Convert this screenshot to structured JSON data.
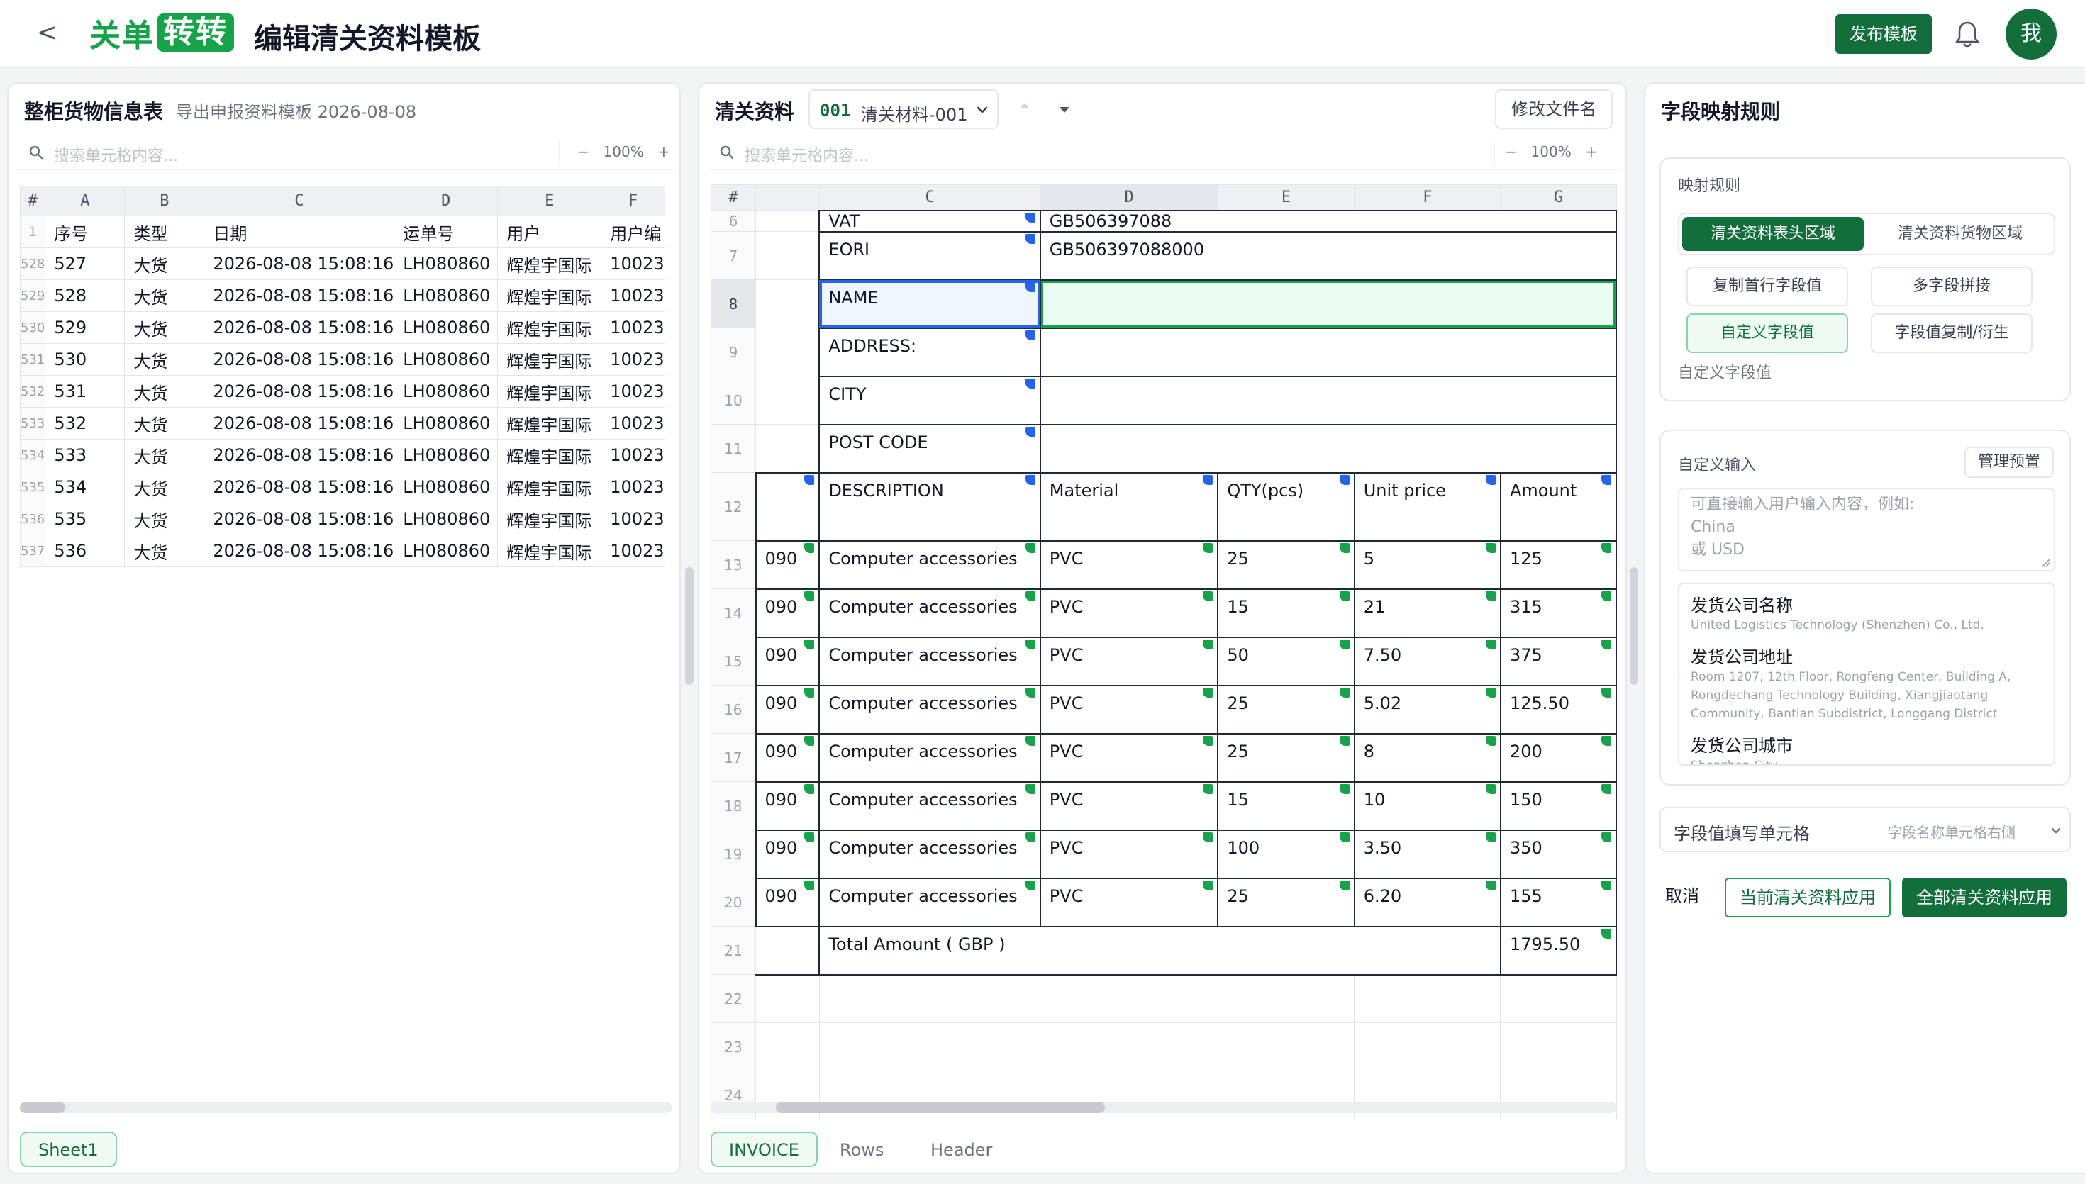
{
  "app": {
    "back": "<",
    "logo_a": "关单",
    "logo_b": "转转",
    "title": "编辑清关资料模板",
    "publish": "发布模板",
    "avatar": "我"
  },
  "left": {
    "title": "整柜货物信息表",
    "subtitle": "导出申报资料模板 2026-08-08",
    "search_placeholder": "搜索单元格内容...",
    "zoom_minus": "−",
    "zoom": "100%",
    "zoom_plus": "+",
    "columns": [
      "#",
      "A",
      "B",
      "C",
      "D",
      "E",
      "F"
    ],
    "header_row": {
      "n": "1",
      "cells": [
        "序号",
        "类型",
        "日期",
        "运单号",
        "用户",
        "用户编"
      ]
    },
    "rows": [
      {
        "n": "528",
        "cells": [
          "527",
          "大货",
          "2026-08-08 15:08:16",
          "LH080860",
          "辉煌宇国际",
          "10023"
        ]
      },
      {
        "n": "529",
        "cells": [
          "528",
          "大货",
          "2026-08-08 15:08:16",
          "LH080860",
          "辉煌宇国际",
          "10023"
        ]
      },
      {
        "n": "530",
        "cells": [
          "529",
          "大货",
          "2026-08-08 15:08:16",
          "LH080860",
          "辉煌宇国际",
          "10023"
        ]
      },
      {
        "n": "531",
        "cells": [
          "530",
          "大货",
          "2026-08-08 15:08:16",
          "LH080860",
          "辉煌宇国际",
          "10023"
        ]
      },
      {
        "n": "532",
        "cells": [
          "531",
          "大货",
          "2026-08-08 15:08:16",
          "LH080860",
          "辉煌宇国际",
          "10023"
        ]
      },
      {
        "n": "533",
        "cells": [
          "532",
          "大货",
          "2026-08-08 15:08:16",
          "LH080860",
          "辉煌宇国际",
          "10023"
        ]
      },
      {
        "n": "534",
        "cells": [
          "533",
          "大货",
          "2026-08-08 15:08:16",
          "LH080860",
          "辉煌宇国际",
          "10023"
        ]
      },
      {
        "n": "535",
        "cells": [
          "534",
          "大货",
          "2026-08-08 15:08:16",
          "LH080860",
          "辉煌宇国际",
          "10023"
        ]
      },
      {
        "n": "536",
        "cells": [
          "535",
          "大货",
          "2026-08-08 15:08:16",
          "LH080860",
          "辉煌宇国际",
          "10023"
        ]
      },
      {
        "n": "537",
        "cells": [
          "536",
          "大货",
          "2026-08-08 15:08:16",
          "LH080860",
          "辉煌宇国际",
          "10023"
        ]
      }
    ],
    "sheet_tab": "Sheet1"
  },
  "mid": {
    "title": "清关资料",
    "doc_code": "001",
    "doc_name": "清关材料-001",
    "rename": "修改文件名",
    "search_placeholder": "搜索单元格内容...",
    "zoom_minus": "−",
    "zoom": "100%",
    "zoom_plus": "+",
    "columns": [
      "#",
      "",
      "C",
      "D",
      "E",
      "F",
      "G"
    ],
    "info_rows": [
      {
        "n": "6",
        "label": "VAT",
        "value": "GB506397088"
      },
      {
        "n": "7",
        "label": "EORI",
        "value": "GB506397088000"
      },
      {
        "n": "8",
        "label": "NAME",
        "value": ""
      },
      {
        "n": "9",
        "label": "ADDRESS:",
        "value": ""
      },
      {
        "n": "10",
        "label": "CITY",
        "value": ""
      },
      {
        "n": "11",
        "label": "POST CODE",
        "value": ""
      }
    ],
    "table_header": {
      "n": "12",
      "cells": [
        "",
        "DESCRIPTION",
        "Material",
        "QTY(pcs)",
        "Unit price",
        "Amount"
      ]
    },
    "items": [
      {
        "n": "13",
        "cells": [
          "090",
          "Computer accessories",
          "PVC",
          "25",
          "5",
          "125"
        ]
      },
      {
        "n": "14",
        "cells": [
          "090",
          "Computer accessories",
          "PVC",
          "15",
          "21",
          "315"
        ]
      },
      {
        "n": "15",
        "cells": [
          "090",
          "Computer accessories",
          "PVC",
          "50",
          "7.50",
          "375"
        ]
      },
      {
        "n": "16",
        "cells": [
          "090",
          "Computer accessories",
          "PVC",
          "25",
          "5.02",
          "125.50"
        ]
      },
      {
        "n": "17",
        "cells": [
          "090",
          "Computer accessories",
          "PVC",
          "25",
          "8",
          "200"
        ]
      },
      {
        "n": "18",
        "cells": [
          "090",
          "Computer accessories",
          "PVC",
          "15",
          "10",
          "150"
        ]
      },
      {
        "n": "19",
        "cells": [
          "090",
          "Computer accessories",
          "PVC",
          "100",
          "3.50",
          "350"
        ]
      },
      {
        "n": "20",
        "cells": [
          "090",
          "Computer accessories",
          "PVC",
          "25",
          "6.20",
          "155"
        ]
      }
    ],
    "total": {
      "n": "21",
      "label": "Total Amount ( GBP )",
      "value": "1795.50"
    },
    "empty_rows": [
      "22",
      "23",
      "24"
    ],
    "tabs": [
      "INVOICE",
      "Rows",
      "Header"
    ]
  },
  "right": {
    "title": "字段映射规则",
    "rule_label": "映射规则",
    "seg": [
      "清关资料表头区域",
      "清关资料货物区域"
    ],
    "options": [
      "复制首行字段值",
      "多字段拼接",
      "自定义字段值",
      "字段值复制/衍生"
    ],
    "mode_caption": "自定义字段值",
    "custom_input_label": "自定义输入",
    "manage_preset": "管理预置",
    "textarea_placeholder_1": "可直接输入用户输入内容，例如:",
    "textarea_placeholder_2": "China",
    "textarea_placeholder_3": "或 USD",
    "presets": [
      {
        "title": "发货公司名称",
        "value": "United Logistics Technology (Shenzhen) Co., Ltd."
      },
      {
        "title": "发货公司地址",
        "value": "Room 1207, 12th Floor, Rongfeng Center, Building A, Rongdechang Technology Building, Xiangjiaotang Community, Bantian Subdistrict, Longgang District"
      },
      {
        "title": "发货公司城市",
        "value": "Shenzhen City"
      }
    ],
    "fill_cell_label": "字段值填写单元格",
    "fill_cell_value": "字段名称单元格右侧",
    "cancel": "取消",
    "apply_current": "当前清关资料应用",
    "apply_all": "全部清关资料应用"
  },
  "colors": {
    "brand": "#126e3b",
    "brand_light": "#16a34a",
    "selection_blue": "#2563eb",
    "flag_blue": "#2563eb",
    "flag_green": "#16a34a"
  },
  "icons": [
    "back-icon",
    "bell-icon",
    "search-icon",
    "chevron-down-icon",
    "arrow-up-icon",
    "arrow-down-icon",
    "resize-icon"
  ]
}
